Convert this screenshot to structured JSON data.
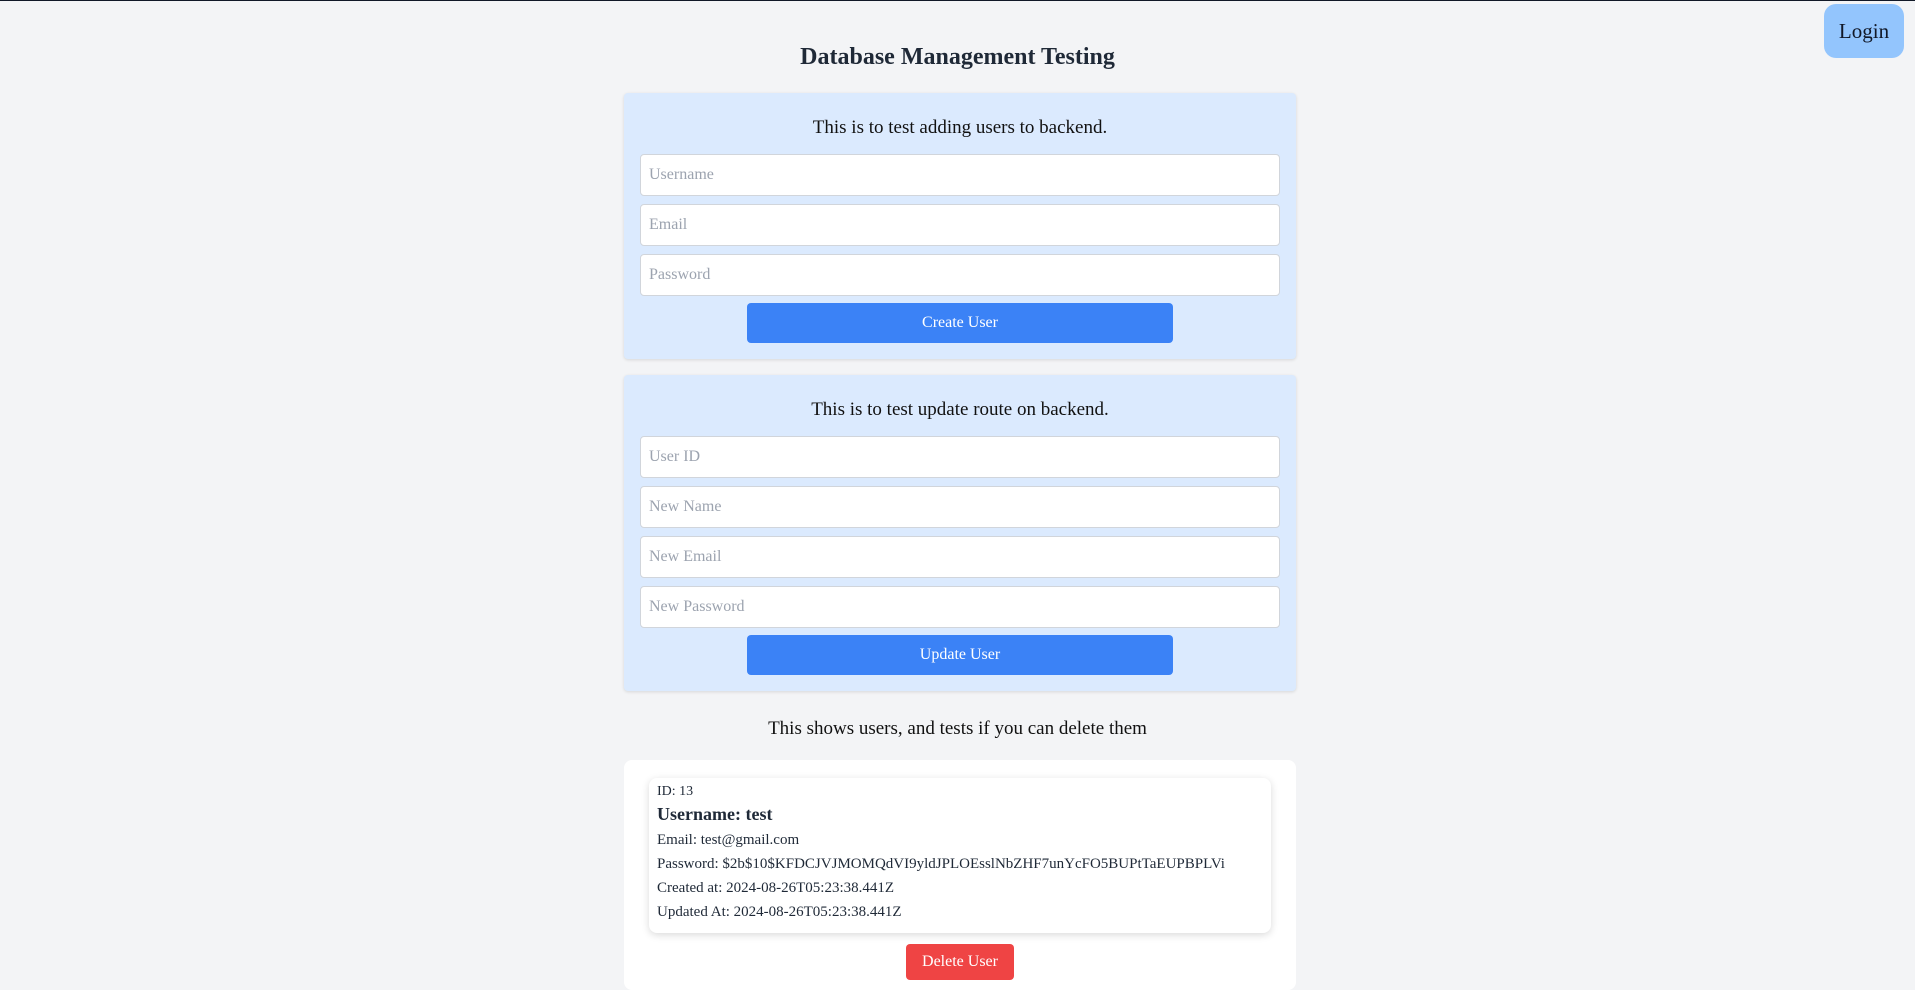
{
  "header": {
    "login_label": "Login",
    "title": "Database Management Testing"
  },
  "create_form": {
    "description": "This is to test adding users to backend.",
    "username_placeholder": "Username",
    "email_placeholder": "Email",
    "password_placeholder": "Password",
    "submit_label": "Create User"
  },
  "update_form": {
    "description": "This is to test update route on backend.",
    "user_id_placeholder": "User ID",
    "new_name_placeholder": "New Name",
    "new_email_placeholder": "New Email",
    "new_password_placeholder": "New Password",
    "submit_label": "Update User"
  },
  "users_section": {
    "description": "This shows users, and tests if you can delete them",
    "users": [
      {
        "id_text": "ID: 13",
        "username_text": "Username: test",
        "email_text": "Email: test@gmail.com",
        "password_text": "Password: $2b$10$KFDCJVJMOMQdVI9yldJPLOEsslNbZHF7unYcFO5BUPtTaEUPBPLVi",
        "created_text": "Created at: 2024-08-26T05:23:38.441Z",
        "updated_text": "Updated At: 2024-08-26T05:23:38.441Z",
        "delete_label": "Delete User"
      }
    ]
  },
  "colors": {
    "background": "#f3f4f6",
    "panel": "#dbeafe",
    "primary": "#3b82f6",
    "login": "#93c5fd",
    "danger": "#ef4444"
  }
}
